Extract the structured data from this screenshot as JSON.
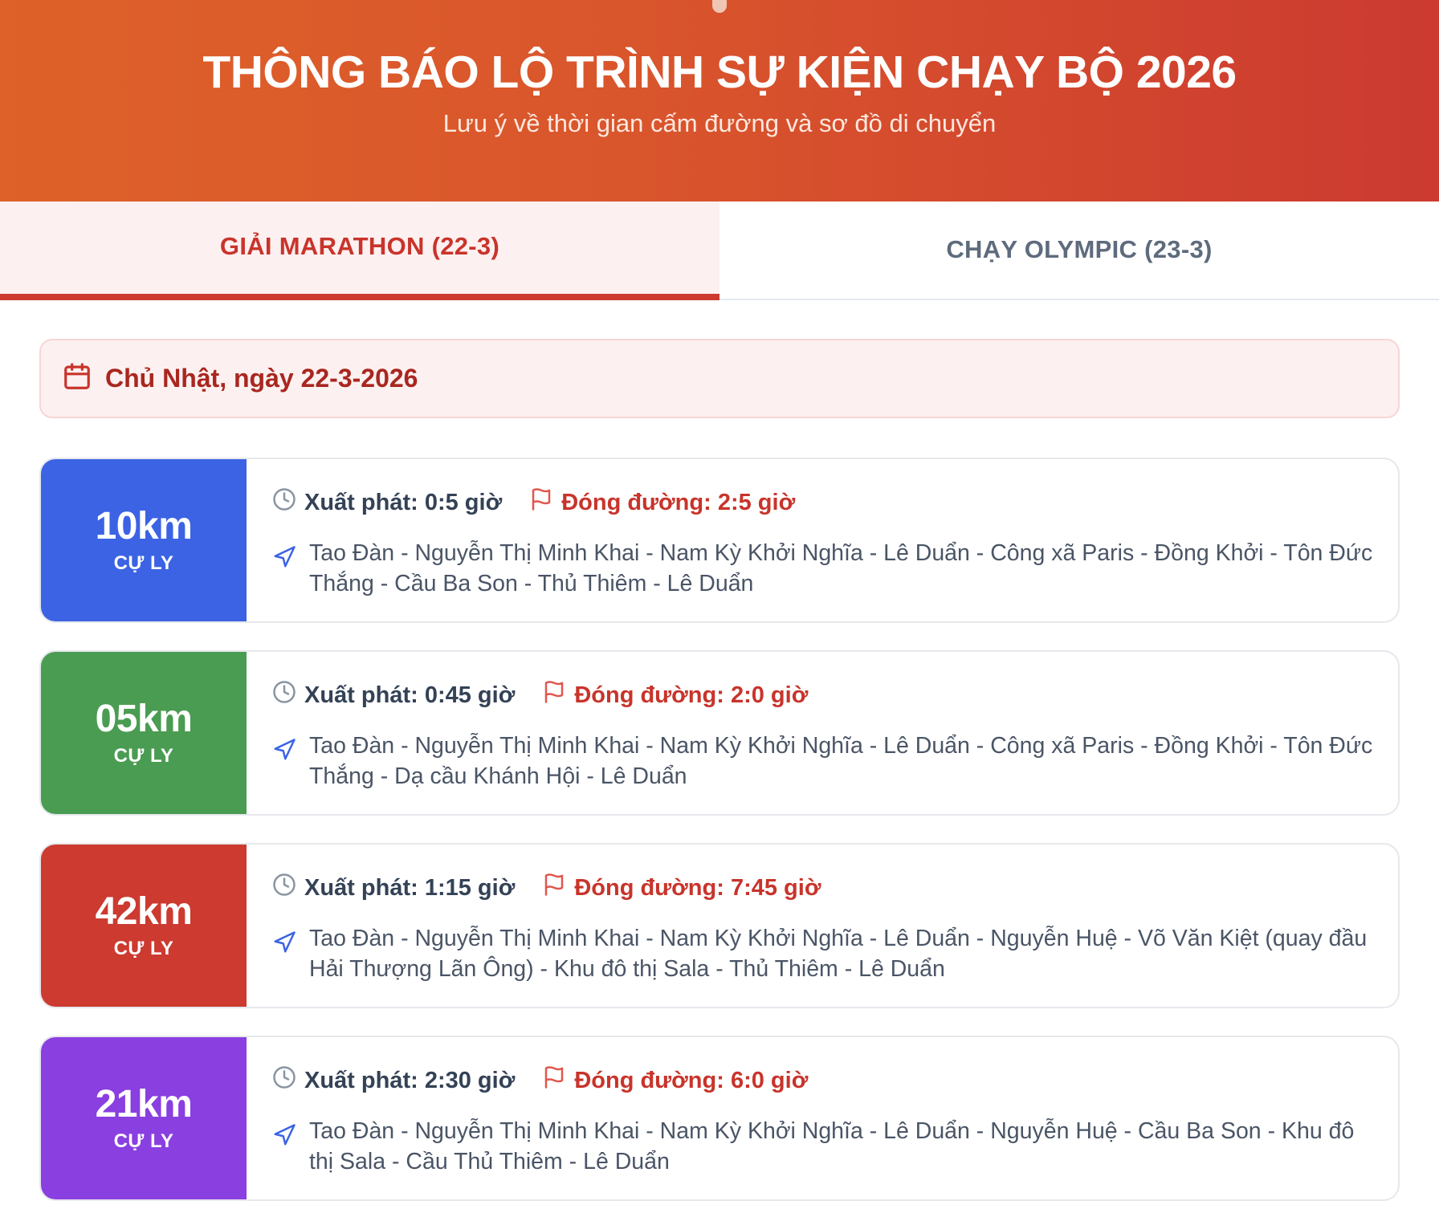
{
  "header": {
    "title": "THÔNG BÁO LỘ TRÌNH SỰ KIỆN CHẠY BỘ 2026",
    "subtitle": "Lưu ý về thời gian cấm đường và sơ đồ di chuyển"
  },
  "tabs": [
    {
      "label": "GIẢI MARATHON (22-3)",
      "active": true
    },
    {
      "label": "CHẠY OLYMPIC (23-3)",
      "active": false
    }
  ],
  "date_banner": {
    "icon": "calendar-icon",
    "text": "Chủ Nhật, ngày 22-3-2026"
  },
  "colors": {
    "accent": "#cc3a30",
    "blue": "#3b63e4",
    "green": "#4a9c52",
    "red": "#cc3a30",
    "purple": "#8a3fe0"
  },
  "routes": [
    {
      "distance": "10km",
      "label": "CỰ LY",
      "color": "#3b63e4",
      "start": "Xuất phát: 0:5 giờ",
      "close": "Đóng đường: 2:5 giờ",
      "path": "Tao Đàn - Nguyễn Thị Minh Khai - Nam Kỳ Khởi Nghĩa - Lê Duẩn - Công xã Paris - Đồng Khởi - Tôn Đức Thắng - Cầu Ba Son - Thủ Thiêm - Lê Duẩn"
    },
    {
      "distance": "05km",
      "label": "CỰ LY",
      "color": "#4a9c52",
      "start": "Xuất phát: 0:45 giờ",
      "close": "Đóng đường: 2:0 giờ",
      "path": "Tao Đàn - Nguyễn Thị Minh Khai - Nam Kỳ Khởi Nghĩa - Lê Duẩn - Công xã Paris - Đồng Khởi - Tôn Đức Thắng - Dạ cầu Khánh Hội - Lê Duẩn"
    },
    {
      "distance": "42km",
      "label": "CỰ LY",
      "color": "#cc3a30",
      "start": "Xuất phát: 1:15 giờ",
      "close": "Đóng đường: 7:45 giờ",
      "path": "Tao Đàn - Nguyễn Thị Minh Khai - Nam Kỳ Khởi Nghĩa - Lê Duẩn - Nguyễn Huệ - Võ Văn Kiệt (quay đầu Hải Thượng Lãn Ông) - Khu đô thị Sala - Thủ Thiêm - Lê Duẩn"
    },
    {
      "distance": "21km",
      "label": "CỰ LY",
      "color": "#8a3fe0",
      "start": "Xuất phát: 2:30 giờ",
      "close": "Đóng đường: 6:0 giờ",
      "path": "Tao Đàn - Nguyễn Thị Minh Khai - Nam Kỳ Khởi Nghĩa - Lê Duẩn - Nguyễn Huệ - Cầu Ba Son - Khu đô thị Sala - Cầu Thủ Thiêm - Lê Duẩn"
    }
  ]
}
